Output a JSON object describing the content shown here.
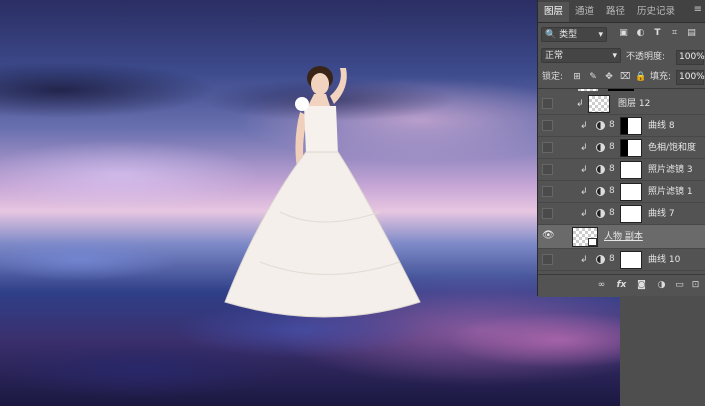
{
  "panel": {
    "tabs": [
      {
        "label": "图层",
        "active": true
      },
      {
        "label": "通道",
        "active": false
      },
      {
        "label": "路径",
        "active": false
      },
      {
        "label": "历史记录",
        "active": false
      }
    ],
    "menu_icon": "menu-icon"
  },
  "filter": {
    "kind_label": "类型",
    "icons": [
      "image-filter-icon",
      "adjustment-filter-icon",
      "type-filter-icon",
      "shape-filter-icon",
      "smartobject-filter-icon"
    ]
  },
  "blend": {
    "mode": "正常",
    "opacity_label": "不透明度:",
    "opacity_value": "100%"
  },
  "lock": {
    "label": "锁定:",
    "fill_label": "填充:",
    "fill_value": "100%"
  },
  "layers": [
    {
      "name": "图层 12",
      "kind": "pixel",
      "clipped": true,
      "visible": false
    },
    {
      "name": "曲线 8",
      "kind": "adjustment",
      "clipped": true,
      "visible": false,
      "mask": "dark"
    },
    {
      "name": "色相/饱和度",
      "kind": "adjustment",
      "clipped": true,
      "visible": false,
      "mask": "dark"
    },
    {
      "name": "照片滤镜 3",
      "kind": "adjustment",
      "clipped": true,
      "visible": false,
      "mask": "white"
    },
    {
      "name": "照片滤镜 1",
      "kind": "adjustment",
      "clipped": true,
      "visible": false,
      "mask": "white"
    },
    {
      "name": "曲线 7",
      "kind": "adjustment",
      "clipped": true,
      "visible": false,
      "mask": "white"
    },
    {
      "name": "人物 副本",
      "kind": "smart",
      "clipped": false,
      "visible": true,
      "selected": true
    },
    {
      "name": "曲线 10",
      "kind": "adjustment",
      "clipped": true,
      "visible": false,
      "mask": "white"
    }
  ],
  "footer_icons": [
    "link-icon",
    "fx-icon",
    "mask-icon",
    "adjustment-icon",
    "group-icon",
    "new-layer-icon",
    "trash-icon"
  ],
  "colors": {
    "panel_bg": "#535353",
    "tab_bar": "#424242",
    "selected_row": "#6a6a6a"
  }
}
